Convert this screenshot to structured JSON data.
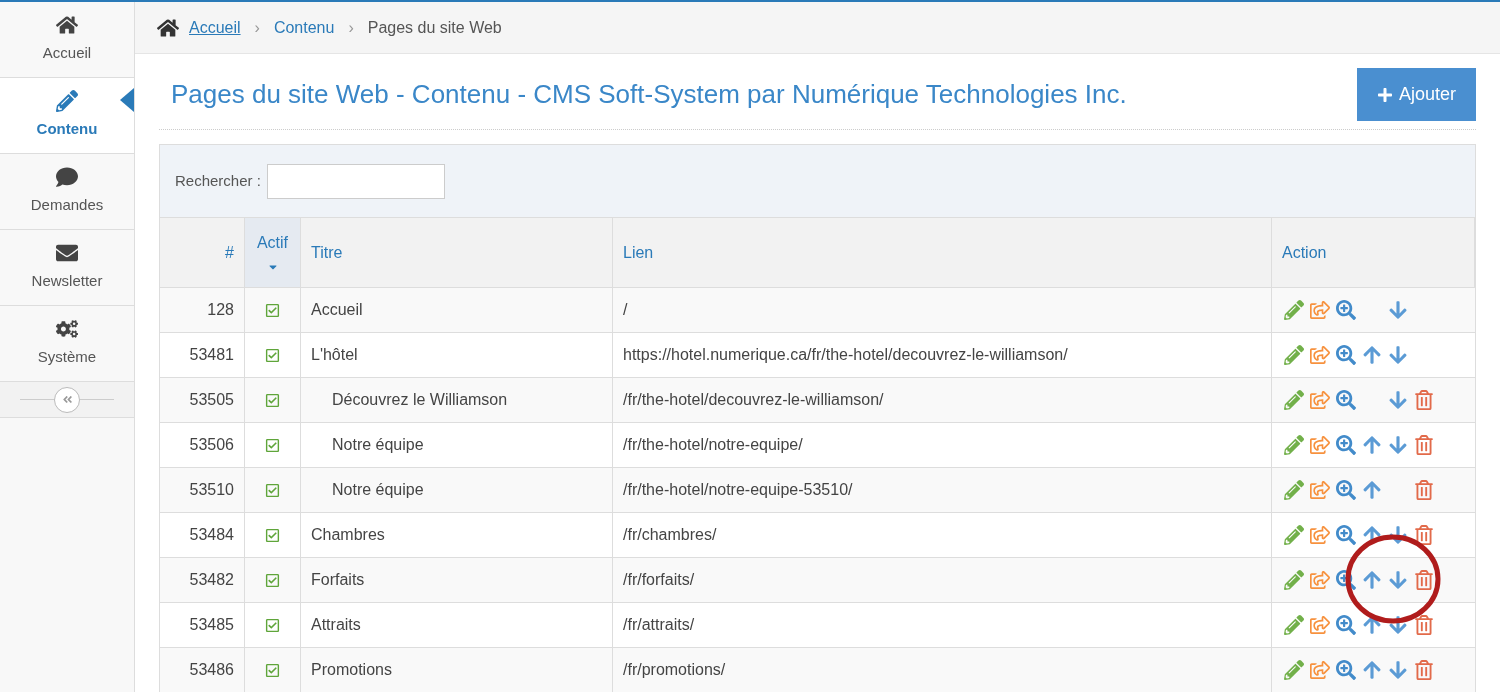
{
  "sidebar": {
    "items": [
      {
        "label": "Accueil",
        "selected": false
      },
      {
        "label": "Contenu",
        "selected": true
      },
      {
        "label": "Demandes",
        "selected": false
      },
      {
        "label": "Newsletter",
        "selected": false
      },
      {
        "label": "Système",
        "selected": false
      }
    ]
  },
  "breadcrumb": [
    {
      "label": "Accueil",
      "kind": "link"
    },
    {
      "separator": "›",
      "label": "Contenu",
      "kind": "link"
    },
    {
      "separator": "›",
      "label": "Pages du site Web",
      "kind": "current"
    }
  ],
  "page_title": "Pages du site Web - Contenu - CMS Soft-System par Numérique Technologies Inc.",
  "add_button": "Ajouter",
  "search": {
    "label": "Rechercher :"
  },
  "table": {
    "columns": [
      {
        "label": "#",
        "sorted": false
      },
      {
        "label": "Actif",
        "sorted": true
      },
      {
        "label": "Titre",
        "sorted": false
      },
      {
        "label": "Lien",
        "sorted": false
      },
      {
        "label": "Action",
        "sorted": false
      }
    ],
    "rows": [
      {
        "id": "128",
        "active": true,
        "title": "Accueil",
        "link": "/",
        "actions": {
          "edit": true,
          "share": true,
          "view": true,
          "up": false,
          "down": true,
          "delete": false
        }
      },
      {
        "id": "53481",
        "active": true,
        "title": "L'hôtel",
        "link": "https://hotel.numerique.ca/fr/the-hotel/decouvrez-le-williamson/",
        "actions": {
          "edit": true,
          "share": true,
          "view": true,
          "up": true,
          "down": true,
          "delete": false
        },
        "children": [
          {
            "id": "53505",
            "active": true,
            "title": "Découvrez le Williamson",
            "link": "/fr/the-hotel/decouvrez-le-williamson/",
            "actions": {
              "edit": true,
              "share": true,
              "view": true,
              "up": false,
              "down": true,
              "delete": true
            }
          },
          {
            "id": "53506",
            "active": true,
            "title": "Notre équipe",
            "link": "/fr/the-hotel/notre-equipe/",
            "actions": {
              "edit": true,
              "share": true,
              "view": true,
              "up": true,
              "down": true,
              "delete": true
            }
          },
          {
            "id": "53510",
            "active": true,
            "title": "Notre équipe",
            "link": "/fr/the-hotel/notre-equipe-53510/",
            "actions": {
              "edit": true,
              "share": true,
              "view": true,
              "up": true,
              "down": false,
              "delete": true
            }
          }
        ]
      },
      {
        "id": "53484",
        "active": true,
        "title": "Chambres",
        "link": "/fr/chambres/",
        "actions": {
          "edit": true,
          "share": true,
          "view": true,
          "up": true,
          "down": true,
          "delete": true
        }
      },
      {
        "id": "53482",
        "active": true,
        "title": "Forfaits",
        "link": "/fr/forfaits/",
        "actions": {
          "edit": true,
          "share": true,
          "view": true,
          "up": true,
          "down": true,
          "delete": true
        }
      },
      {
        "id": "53485",
        "active": true,
        "title": "Attraits",
        "link": "/fr/attraits/",
        "actions": {
          "edit": true,
          "share": true,
          "view": true,
          "up": true,
          "down": true,
          "delete": true
        }
      },
      {
        "id": "53486",
        "active": true,
        "title": "Promotions",
        "link": "/fr/promotions/",
        "actions": {
          "edit": true,
          "share": true,
          "view": true,
          "up": true,
          "down": true,
          "delete": true
        }
      }
    ]
  },
  "annotation": {
    "kind": "circle",
    "color": "#b01c1c"
  }
}
